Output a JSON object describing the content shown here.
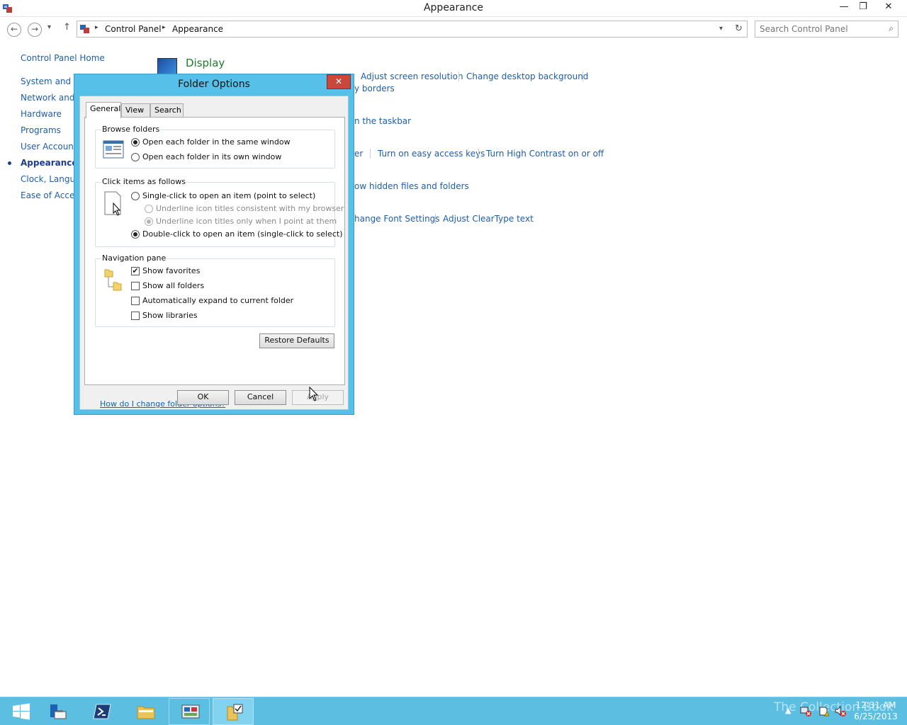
{
  "window": {
    "title": "Appearance",
    "minimize_glyph": "—",
    "restore_glyph": "❐",
    "close_glyph": "✕"
  },
  "nav": {
    "back_glyph": "←",
    "forward_glyph": "→",
    "up_glyph": "↑",
    "dropdown_glyph": "▾",
    "breadcrumb_sep": "▸",
    "breadcrumb": [
      "Control Panel",
      "Appearance"
    ],
    "refresh_glyph": "↻",
    "search_placeholder": "Search Control Panel",
    "search_glyph": "⌕"
  },
  "sidebar": {
    "items": [
      {
        "label": "Control Panel Home"
      },
      {
        "label": "System and Se"
      },
      {
        "label": "Network and I"
      },
      {
        "label": "Hardware"
      },
      {
        "label": "Programs"
      },
      {
        "label": "User Accounts"
      },
      {
        "label": "Appearance",
        "current": true
      },
      {
        "label": "Clock, Langua"
      },
      {
        "label": "Ease of Access"
      }
    ]
  },
  "main": {
    "display_title": "Display",
    "links": {
      "adjust_resolution": "Adjust screen resolution",
      "change_background": "Change desktop background",
      "borders": "y borders",
      "taskbar": "n the taskbar",
      "er": "er",
      "easy_access_keys": "Turn on easy access keys",
      "high_contrast": "Turn High Contrast on or off",
      "hidden_files": "ow hidden files and folders",
      "font_settings": "hange Font Settings",
      "cleartype": "Adjust ClearType text"
    }
  },
  "dialog": {
    "title": "Folder Options",
    "close_glyph": "✕",
    "tabs": [
      "General",
      "View",
      "Search"
    ],
    "browse": {
      "label": "Browse folders",
      "options": [
        "Open each folder in the same window",
        "Open each folder in its own window"
      ],
      "selected": 0
    },
    "click": {
      "label": "Click items as follows",
      "single": "Single-click to open an item (point to select)",
      "underline_browser": "Underline icon titles consistent with my browser",
      "underline_point": "Underline icon titles only when I point at them",
      "double": "Double-click to open an item (single-click to select)",
      "selected": "double"
    },
    "navpane": {
      "label": "Navigation pane",
      "options": [
        {
          "label": "Show favorites",
          "checked": true
        },
        {
          "label": "Show all folders",
          "checked": false
        },
        {
          "label": "Automatically expand to current folder",
          "checked": false
        },
        {
          "label": "Show libraries",
          "checked": false
        }
      ],
      "check_glyph": "✔"
    },
    "restore_defaults": "Restore Defaults",
    "help_link": "How do I change folder options?",
    "buttons": {
      "ok": "OK",
      "cancel": "Cancel",
      "apply": "Apply"
    }
  },
  "taskbar": {
    "clock_time": "12:31 AM",
    "clock_date": "6/25/2013",
    "tray_arrow": "▲",
    "watermark": "The Collection Book"
  },
  "colors": {
    "accent": "#5cbfe2",
    "link": "#1e5ea8",
    "category_title": "#1f7a2b",
    "close_red": "#c9483b"
  }
}
